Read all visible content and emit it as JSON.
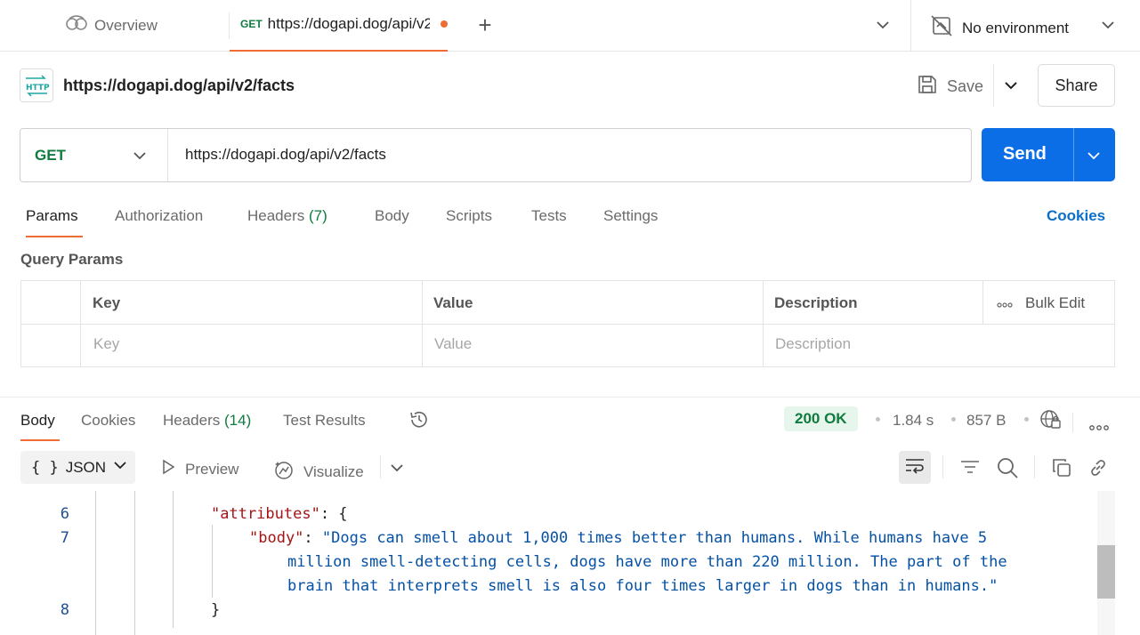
{
  "tabs": {
    "overview_label": "Overview",
    "active_method": "GET",
    "active_url": "https://dogapi.dog/api/v2/facts",
    "environment": "No environment"
  },
  "request": {
    "title": "https://dogapi.dog/api/v2/facts",
    "save_label": "Save",
    "share_label": "Share",
    "method": "GET",
    "url": "https://dogapi.dog/api/v2/facts",
    "send_label": "Send"
  },
  "request_tabs": {
    "params": "Params",
    "authorization": "Authorization",
    "headers": "Headers",
    "headers_count": "(7)",
    "body": "Body",
    "scripts": "Scripts",
    "tests": "Tests",
    "settings": "Settings",
    "cookies": "Cookies"
  },
  "query_params": {
    "label": "Query Params",
    "columns": [
      "Key",
      "Value",
      "Description"
    ],
    "bulk_edit": "Bulk Edit",
    "placeholders": {
      "key": "Key",
      "value": "Value",
      "description": "Description"
    }
  },
  "response": {
    "tabs": {
      "body": "Body",
      "cookies": "Cookies",
      "headers": "Headers",
      "headers_count": "(14)",
      "test_results": "Test Results"
    },
    "status": "200 OK",
    "time": "1.84 s",
    "size": "857 B",
    "format": "JSON",
    "preview": "Preview",
    "visualize": "Visualize"
  },
  "code": {
    "lines": [
      {
        "number": "6",
        "key": "\"attributes\"",
        "rest": ": {"
      },
      {
        "number": "7",
        "key": "\"body\"",
        "rest": ": ",
        "value_lines": [
          "\"Dogs can smell about 1,000 times better than humans. While humans have 5",
          "million smell-detecting cells, dogs have more than 220 million. The part of the",
          "brain that interprets smell is also four times larger in dogs than in humans.\""
        ]
      },
      {
        "number": "8",
        "text": "}"
      }
    ]
  },
  "colors": {
    "accent": "#ef6c35",
    "send": "#0b6ee6",
    "method_get": "#0f7b3e",
    "link": "#0b6ec9"
  }
}
